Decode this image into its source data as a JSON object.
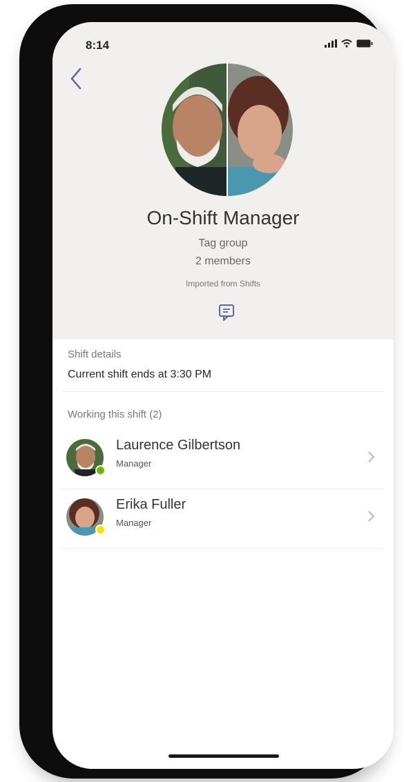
{
  "status_bar": {
    "time": "8:14"
  },
  "group": {
    "name": "On-Shift Manager",
    "type": "Tag group",
    "member_count": "2 members",
    "source": "Imported from Shifts"
  },
  "shift_details": {
    "label": "Shift details",
    "text": "Current shift ends at 3:30 PM"
  },
  "working": {
    "label": "Working this shift (2)",
    "members": [
      {
        "name": "Laurence Gilbertson",
        "role": "Manager",
        "presence_color": "#6bb700"
      },
      {
        "name": "Erika Fuller",
        "role": "Manager",
        "presence_color": "#fce100"
      }
    ]
  },
  "colors": {
    "accent": "#6264a7",
    "header_bg": "#f1f0ef"
  }
}
